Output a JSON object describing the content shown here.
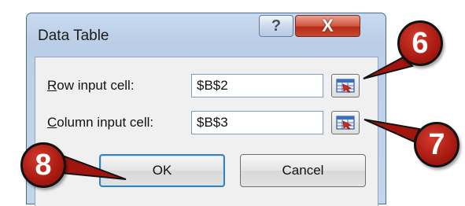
{
  "window": {
    "title": "Data Table",
    "help_icon": "?",
    "close_icon": "X"
  },
  "fields": {
    "row_label_mnemonic": "R",
    "row_label_rest": "ow input cell:",
    "row_value": "$B$2",
    "column_label_mnemonic": "C",
    "column_label_rest": "olumn input cell:",
    "column_value": "$B$3"
  },
  "buttons": {
    "ok": "OK",
    "cancel": "Cancel"
  },
  "callouts": {
    "six": "6",
    "seven": "7",
    "eight": "8"
  },
  "colors": {
    "callout": "#b01d12",
    "titlebar": "#c1d4ec",
    "close_button": "#c9492f"
  },
  "icons": [
    "help-icon",
    "close-icon",
    "range-selector-icon"
  ]
}
